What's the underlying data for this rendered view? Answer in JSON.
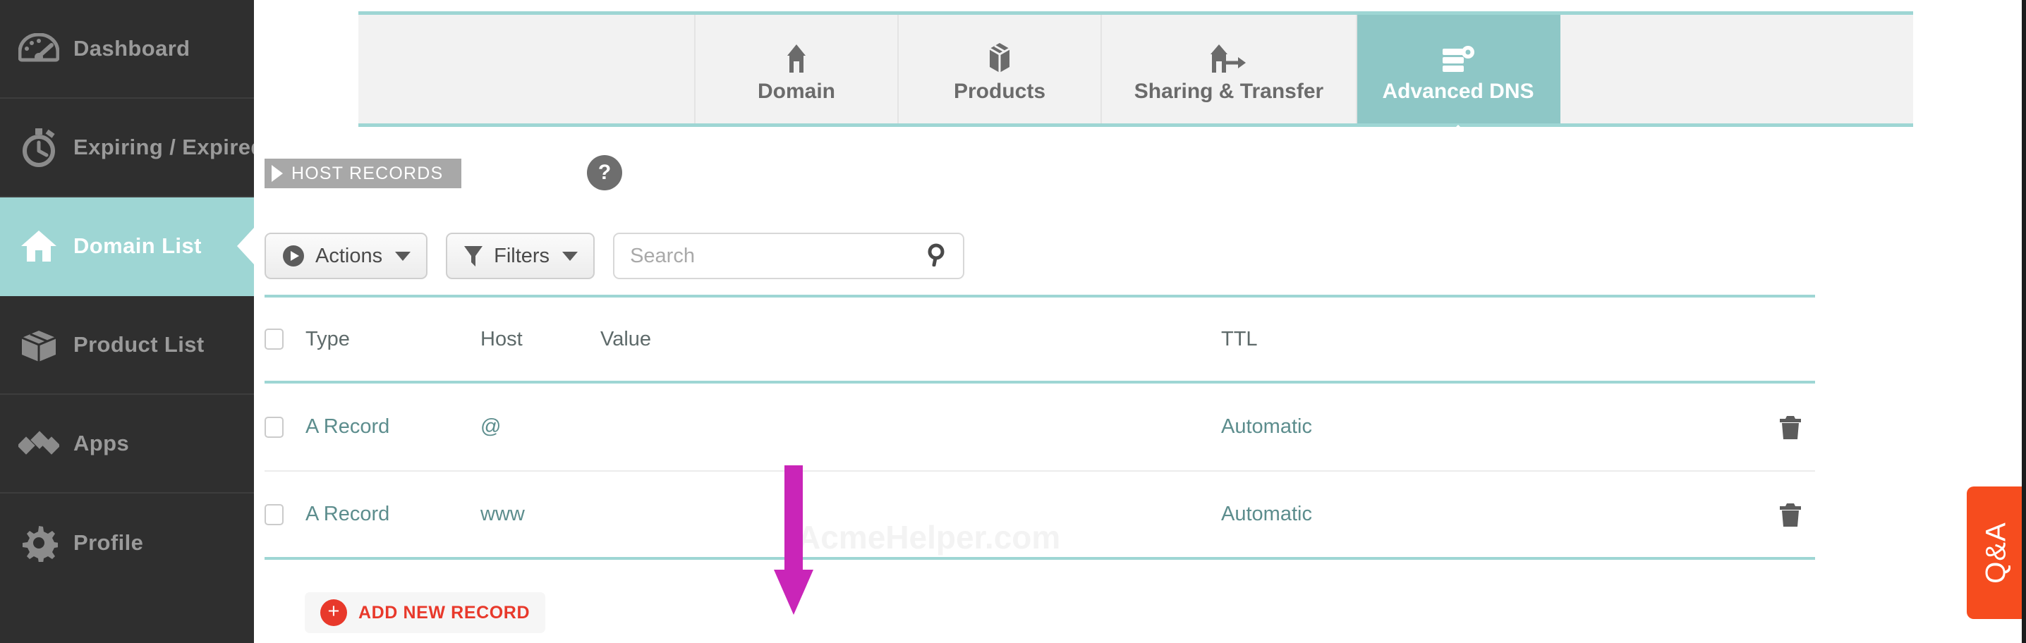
{
  "colors": {
    "sidebar_bg": "#2f2f2f",
    "accent_teal": "#9ed6d4",
    "tab_active": "#8ec7c6",
    "link_teal": "#5c8d8d",
    "add_red": "#e8392b",
    "qa_orange": "#f64c1e",
    "annotation_magenta": "#c925b8",
    "ribbon_gray": "#a8a8a8"
  },
  "sidebar": {
    "items": [
      {
        "label": "Dashboard",
        "icon": "gauge-icon",
        "active": false
      },
      {
        "label": "Expiring / Expired",
        "icon": "stopwatch-icon",
        "active": false
      },
      {
        "label": "Domain List",
        "icon": "house-icon",
        "active": true
      },
      {
        "label": "Product List",
        "icon": "box-icon",
        "active": false
      },
      {
        "label": "Apps",
        "icon": "diamonds-icon",
        "active": false
      },
      {
        "label": "Profile",
        "icon": "gear-icon",
        "active": false
      }
    ]
  },
  "tabs": [
    {
      "label": "Domain",
      "icon": "house-icon",
      "active": false
    },
    {
      "label": "Products",
      "icon": "box-icon",
      "active": false
    },
    {
      "label": "Sharing & Transfer",
      "icon": "share-arrow-icon",
      "active": false
    },
    {
      "label": "Advanced DNS",
      "icon": "dns-server-icon",
      "active": true
    }
  ],
  "section": {
    "ribbon_label": "HOST RECORDS",
    "help_label": "?"
  },
  "toolbar": {
    "actions_label": "Actions",
    "filters_label": "Filters",
    "search_placeholder": "Search",
    "search_value": ""
  },
  "table": {
    "columns": [
      "Type",
      "Host",
      "Value",
      "TTL"
    ],
    "rows": [
      {
        "type": "A Record",
        "host": "@",
        "value": "",
        "ttl": "Automatic"
      },
      {
        "type": "A Record",
        "host": "www",
        "value": "",
        "ttl": "Automatic"
      }
    ]
  },
  "add_record": {
    "label": "ADD NEW RECORD",
    "plus": "+"
  },
  "watermark": {
    "text": "AcmeHelper.com"
  },
  "qa_tab": {
    "label": "Q&A"
  }
}
